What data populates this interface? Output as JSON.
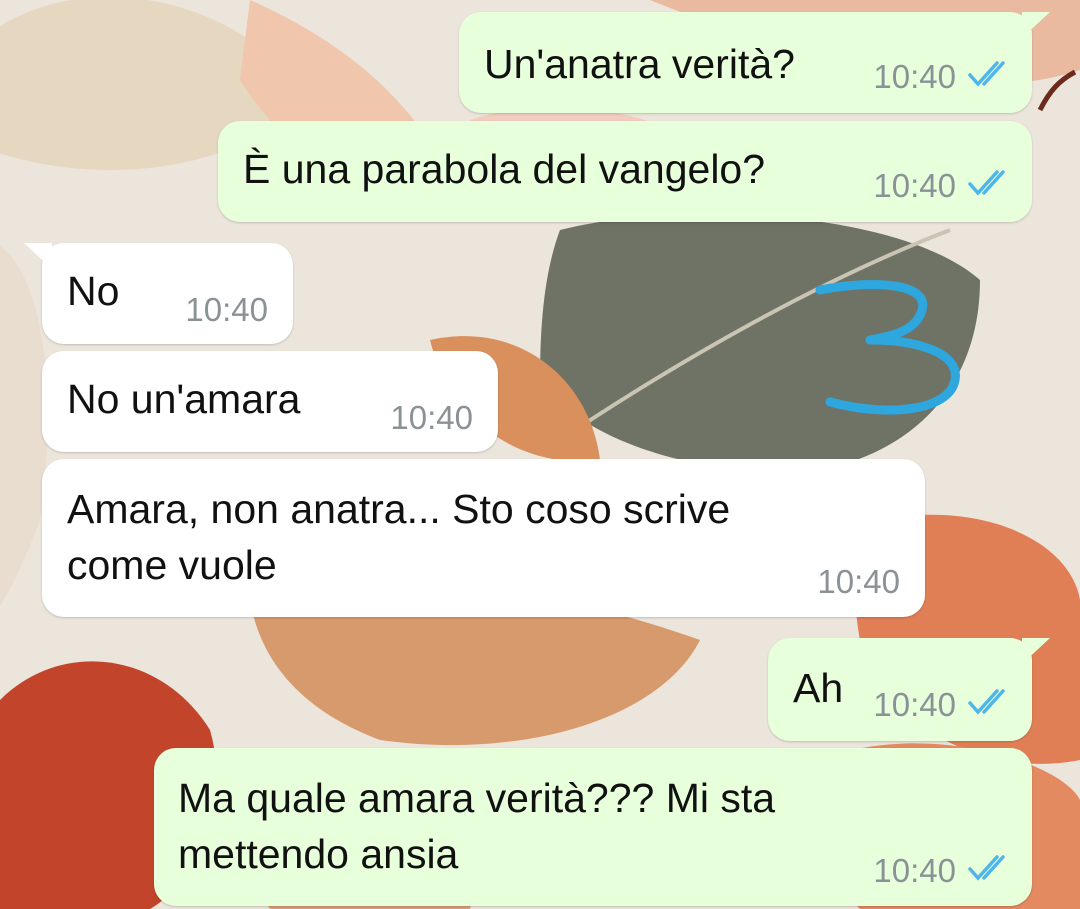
{
  "conversation": {
    "messages": [
      {
        "direction": "outgoing",
        "text": "Un'anatra verità?",
        "time": "10:40",
        "status": "read",
        "tick_color": "#4fb6ec"
      },
      {
        "direction": "outgoing",
        "text": "È una parabola del vangelo?",
        "time": "10:40",
        "status": "read",
        "tick_color": "#4fb6ec"
      },
      {
        "direction": "incoming",
        "text": "No",
        "time": "10:40"
      },
      {
        "direction": "incoming",
        "text": "No un'amara",
        "time": "10:40"
      },
      {
        "direction": "incoming",
        "text": "Amara, non anatra... Sto coso scrive\ncome vuole",
        "time": "10:40"
      },
      {
        "direction": "outgoing",
        "text": "Ah",
        "time": "10:40",
        "status": "read",
        "tick_color": "#4fb6ec"
      },
      {
        "direction": "outgoing",
        "text": "Ma quale amara verità??? Mi sta\nmettendo ansia",
        "time": "10:40",
        "status": "read",
        "tick_color": "#4fb6ec"
      }
    ]
  },
  "annotation": {
    "text": "3",
    "color": "#2ea6de"
  },
  "theme": {
    "outgoing_bubble": "#e7ffdb",
    "incoming_bubble": "#ffffff",
    "timestamp_color": "#8a9296"
  }
}
